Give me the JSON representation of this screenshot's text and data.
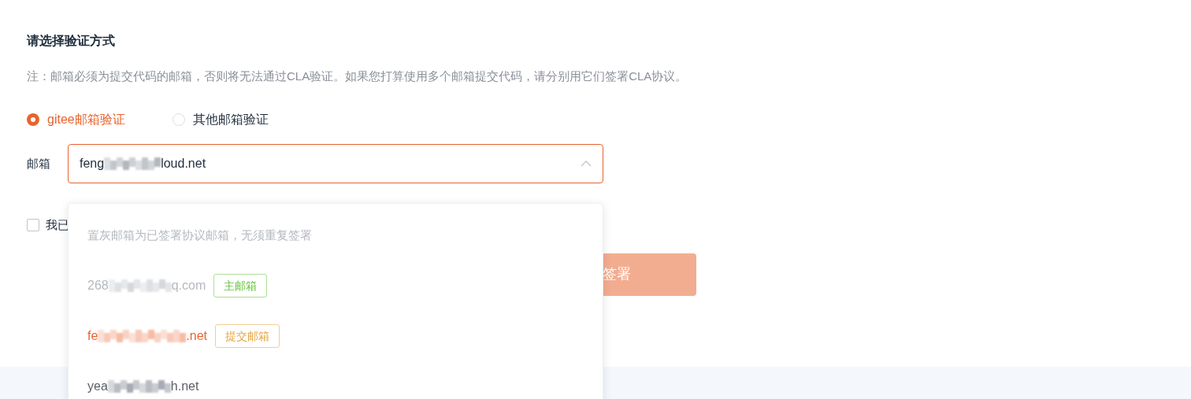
{
  "heading": "请选择验证方式",
  "note": "注：邮箱必须为提交代码的邮箱，否则将无法通过CLA验证。如果您打算使用多个邮箱提交代码，请分别用它们签署CLA协议。",
  "methods": [
    {
      "label": "gitee邮箱验证",
      "selected": true
    },
    {
      "label": "其他邮箱验证",
      "selected": false
    }
  ],
  "email_field": {
    "label": "邮箱",
    "value_start": "feng",
    "value_end": "loud.net",
    "expanded": true
  },
  "agree_checkbox": {
    "label": "我已",
    "checked": false
  },
  "sign_button": {
    "label": "签署",
    "disabled": true
  },
  "dropdown": {
    "hint": "置灰邮箱为已签署协议邮箱，无须重复签署",
    "options": [
      {
        "start": "268",
        "end": "q.com",
        "disabled": true,
        "selected": false,
        "tag": "主邮箱",
        "color": "#67c23a"
      },
      {
        "start": "fe",
        "end": ".net",
        "disabled": false,
        "selected": true,
        "tag": "提交邮箱",
        "color": "#e6a23c"
      },
      {
        "start": "yea",
        "end": "h.net",
        "disabled": false,
        "selected": false
      }
    ]
  }
}
